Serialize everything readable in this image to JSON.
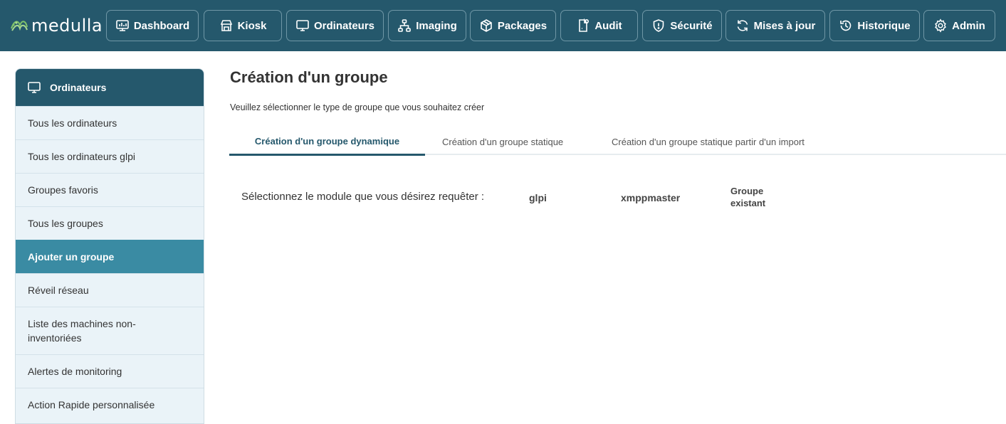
{
  "app": {
    "logo_text": "medulla"
  },
  "nav": [
    {
      "label": "Dashboard",
      "icon": "dashboard-icon"
    },
    {
      "label": "Kiosk",
      "icon": "kiosk-icon"
    },
    {
      "label": "Ordinateurs",
      "icon": "monitor-icon"
    },
    {
      "label": "Imaging",
      "icon": "network-icon"
    },
    {
      "label": "Packages",
      "icon": "package-icon"
    },
    {
      "label": "Audit",
      "icon": "audit-icon"
    },
    {
      "label": "Sécurité",
      "icon": "shield-icon"
    },
    {
      "label": "Mises à jour",
      "icon": "refresh-icon"
    },
    {
      "label": "Historique",
      "icon": "history-icon"
    },
    {
      "label": "Admin",
      "icon": "gear-icon"
    }
  ],
  "sidebar": {
    "header": "Ordinateurs",
    "items": [
      {
        "label": "Tous les ordinateurs"
      },
      {
        "label": "Tous les ordinateurs glpi"
      },
      {
        "label": "Groupes favoris"
      },
      {
        "label": "Tous les groupes"
      },
      {
        "label": "Ajouter un groupe",
        "active": true
      },
      {
        "label": "Réveil réseau"
      },
      {
        "label": "Liste des machines non-inventoriées"
      },
      {
        "label": "Alertes de monitoring"
      },
      {
        "label": "Action Rapide personnalisée"
      }
    ]
  },
  "main": {
    "title": "Création d'un groupe",
    "subtitle": "Veuillez sélectionner le type de groupe que vous souhaitez créer",
    "tabs": [
      {
        "label": "Création d'un groupe dynamique",
        "active": true
      },
      {
        "label": "Création d'un groupe statique"
      },
      {
        "label": "Création d'un groupe statique partir d'un import"
      }
    ],
    "module_label": "Sélectionnez le module que vous désirez requêter :",
    "modules": [
      {
        "label": "glpi"
      },
      {
        "label": "xmppmaster"
      },
      {
        "label": "Groupe existant"
      }
    ]
  },
  "colors": {
    "topbar": "#25586c",
    "active_sidebar": "#3a8ba3",
    "sidebar_bg": "#eaf3f8"
  }
}
